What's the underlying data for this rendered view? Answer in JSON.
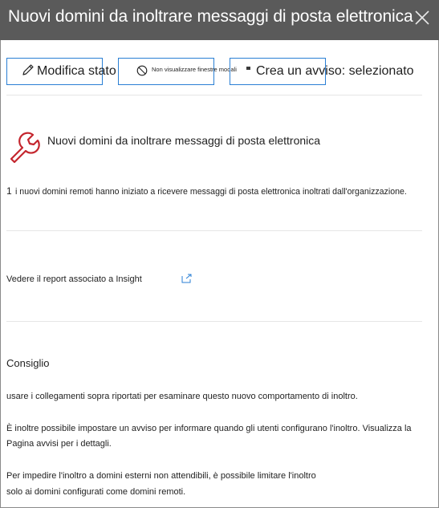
{
  "panel": {
    "title": "Nuovi domini da inoltrare messaggi di posta elettronica",
    "close_icon": "close-icon"
  },
  "toolbar": {
    "edit_label": "Modifica stato",
    "edit_icon": "pencil-icon",
    "hide_label": "Non visualizzare finestre modali",
    "hide_icon": "block-icon",
    "alert_label": "Crea un avviso: selezionato"
  },
  "alert": {
    "icon": "wrench-icon",
    "icon_color": "#c4262e",
    "title": "Nuovi domini da inoltrare messaggi di posta elettronica",
    "count": "1",
    "description": "i nuovi domini remoti hanno iniziato a ricevere messaggi di posta elettronica inoltrati dall'organizzazione."
  },
  "report": {
    "link_label": "Vedere il report associato a Insight",
    "open_icon": "open-in-new-window-icon"
  },
  "advice": {
    "heading": "Consiglio",
    "line1": "usare i collegamenti sopra riportati per esaminare questo nuovo comportamento di inoltro.",
    "line2a": "È inoltre possibile impostare un avviso per informare quando gli utenti configurano l'inoltro. Visualizza la",
    "line2b": "Pagina avvisi per i dettagli.",
    "line3a": "Per impedire l'inoltro a domini esterni non attendibili, è possibile limitare l'inoltro",
    "line3b": "solo ai domini configurati come domini remoti."
  },
  "colors": {
    "header_bg": "#5a5a5a",
    "accent_border": "#2a7fd4"
  }
}
